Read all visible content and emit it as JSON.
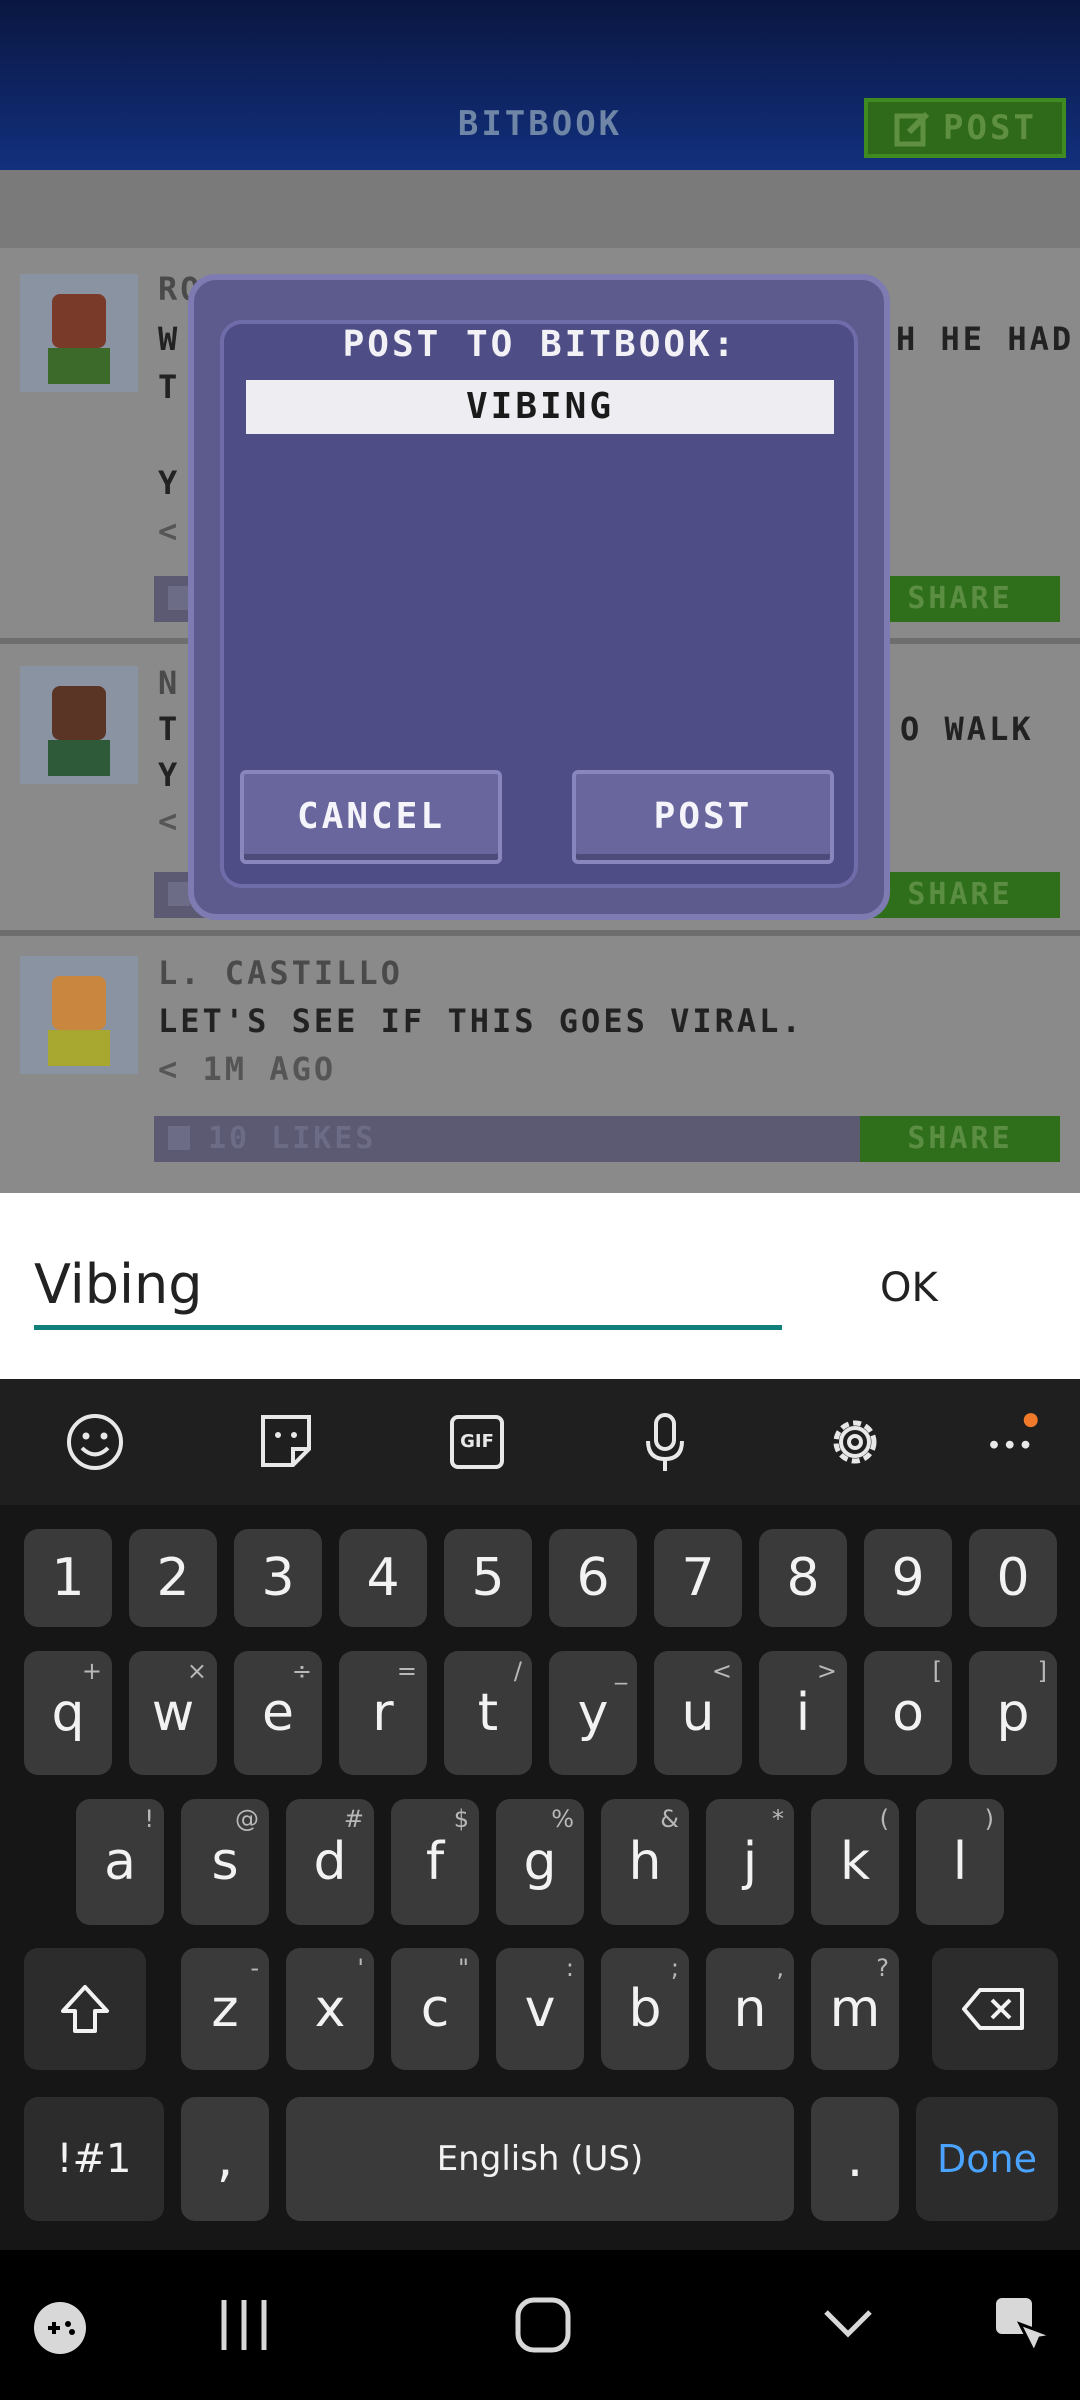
{
  "header": {
    "title": "BITBOOK",
    "post_label": "POST"
  },
  "feed": [
    {
      "name": "ROS",
      "text": "W",
      "text2": "T",
      "line3": "Y",
      "time": "<",
      "fragment_right": "H HE HAD",
      "share": "SHARE"
    },
    {
      "name": "N",
      "text": "T",
      "text2": "Y",
      "time": "<",
      "fragment_right": "O WALK",
      "share": "SHARE"
    },
    {
      "name": "L. CASTILLO",
      "text": "LET'S SEE IF THIS GOES VIRAL.",
      "time": "< 1M AGO",
      "likes": "10 LIKES",
      "share": "SHARE"
    }
  ],
  "dialog": {
    "title": "POST TO BITBOOK:",
    "field_value": "VIBING",
    "cancel_label": "CANCEL",
    "post_label": "POST"
  },
  "input": {
    "value": "Vibing",
    "ok_label": "OK"
  },
  "toolbar": {
    "icons": [
      "emoji-icon",
      "sticker-icon",
      "gif-icon",
      "mic-icon",
      "settings-icon",
      "more-icon"
    ],
    "gif_label": "GIF"
  },
  "keyboard": {
    "numbers": [
      "1",
      "2",
      "3",
      "4",
      "5",
      "6",
      "7",
      "8",
      "9",
      "0"
    ],
    "row1": [
      {
        "k": "q",
        "s": "+"
      },
      {
        "k": "w",
        "s": "×"
      },
      {
        "k": "e",
        "s": "÷"
      },
      {
        "k": "r",
        "s": "="
      },
      {
        "k": "t",
        "s": "/"
      },
      {
        "k": "y",
        "s": "_"
      },
      {
        "k": "u",
        "s": "<"
      },
      {
        "k": "i",
        "s": ">"
      },
      {
        "k": "o",
        "s": "["
      },
      {
        "k": "p",
        "s": "]"
      }
    ],
    "row2": [
      {
        "k": "a",
        "s": "!"
      },
      {
        "k": "s",
        "s": "@"
      },
      {
        "k": "d",
        "s": "#"
      },
      {
        "k": "f",
        "s": "$"
      },
      {
        "k": "g",
        "s": "%"
      },
      {
        "k": "h",
        "s": "&"
      },
      {
        "k": "j",
        "s": "*"
      },
      {
        "k": "k",
        "s": "("
      },
      {
        "k": "l",
        "s": ")"
      }
    ],
    "row3": [
      {
        "k": "z",
        "s": "-"
      },
      {
        "k": "x",
        "s": "'"
      },
      {
        "k": "c",
        "s": "\""
      },
      {
        "k": "v",
        "s": ":"
      },
      {
        "k": "b",
        "s": ";"
      },
      {
        "k": "n",
        "s": ","
      },
      {
        "k": "m",
        "s": "?"
      }
    ],
    "symbols_label": "!#1",
    "comma": ",",
    "space_label": "English (US)",
    "period": ".",
    "done_label": "Done",
    "accent_color": "#4aa3ff"
  }
}
